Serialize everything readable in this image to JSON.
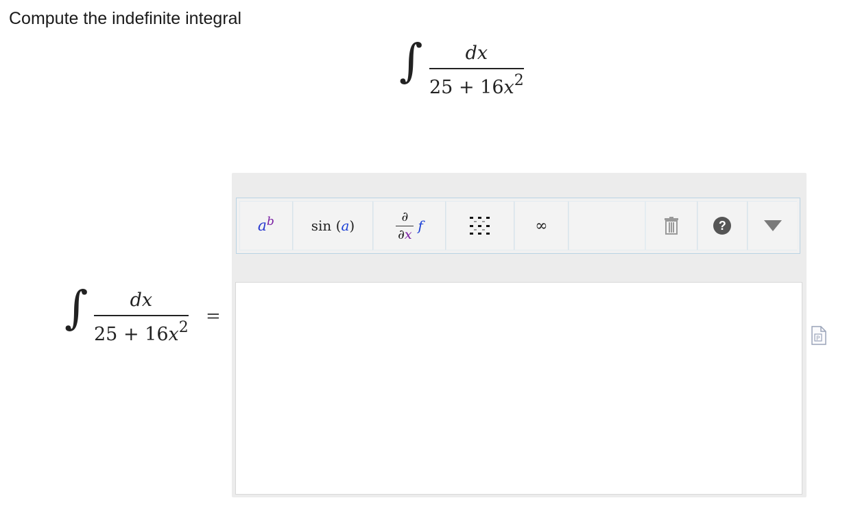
{
  "prompt": "Compute the indefinite integral",
  "integral": {
    "numerator": "dx",
    "denominator_const": "25",
    "denominator_op": "+",
    "denominator_coef": "16",
    "denominator_var": "x",
    "denominator_exp": "2",
    "equals": "="
  },
  "toolbar": {
    "power_base": "a",
    "power_exp": "b",
    "trig_func": "sin",
    "trig_arg": "a",
    "deriv_top": "∂",
    "deriv_bottom_d": "∂",
    "deriv_bottom_var": "x",
    "deriv_f": "f",
    "infinity": "∞",
    "help": "?"
  },
  "answer": {
    "value": ""
  },
  "colors": {
    "accent_blue": "#1a3fd6",
    "accent_purple": "#7a1fa3",
    "toolbar_border": "#b9d3e3",
    "editor_bg": "#ececec"
  }
}
